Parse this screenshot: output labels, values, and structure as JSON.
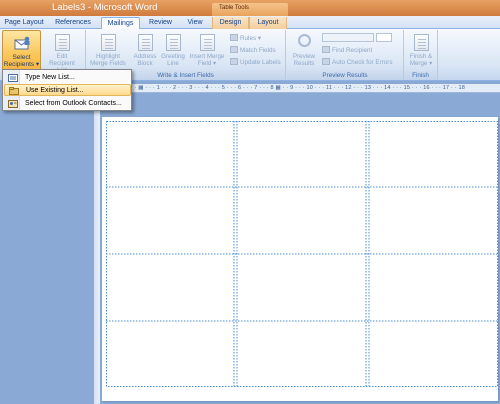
{
  "window": {
    "title": "Labels3 - Microsoft Word",
    "context_tab_group": "Table Tools"
  },
  "tabs": [
    "Page Layout",
    "References",
    "Mailings",
    "Review",
    "View",
    "Design",
    "Layout"
  ],
  "active_tab": "Mailings",
  "ribbon": {
    "start_group": {
      "select_recipients_label": "Select Recipients ▾",
      "edit_recipient_list_label": "Edit Recipient List"
    },
    "write_insert_group": {
      "label": "Write & Insert Fields",
      "highlight_label": "Highlight Merge Fields",
      "address_block_label": "Address Block",
      "greeting_line_label": "Greeting Line",
      "insert_merge_field_label": "Insert Merge Field ▾",
      "rules_label": "Rules ▾",
      "match_fields_label": "Match Fields",
      "update_labels_label": "Update Labels"
    },
    "preview_group": {
      "label": "Preview Results",
      "preview_results_label": "Preview Results",
      "find_recipient_label": "Find Recipient",
      "auto_check_label": "Auto Check for Errors"
    },
    "finish_group": {
      "label": "Finish",
      "finish_merge_label": "Finish & Merge ▾"
    }
  },
  "dropdown_menu": {
    "items": [
      "Type New List...",
      "Use Existing List...",
      "Select from Outlook Contacts..."
    ],
    "highlighted_item": "Use Existing List..."
  },
  "ruler": {
    "text": "· 2 · · · 1 · · · ▦ · · · 1 · · · 2 · · · 3 · · · 4 · · · 5 · · · 6 · · · 7 · · · 8 ▦ · · 9 · · · 10 · · · 11 · · · 12 · · · 13 · · · 14 · · · 15 · · · 16 · · · 17 · · 18"
  },
  "document": {
    "label_grid": {
      "rows": 4,
      "columns": 3
    }
  },
  "colors": {
    "title_bar": "#d88948",
    "ribbon_blue": "#dae6f5",
    "menu_highlight": "#ffd98c",
    "select_button": "#fbc75a",
    "gridlines": "#4b8fd6"
  }
}
